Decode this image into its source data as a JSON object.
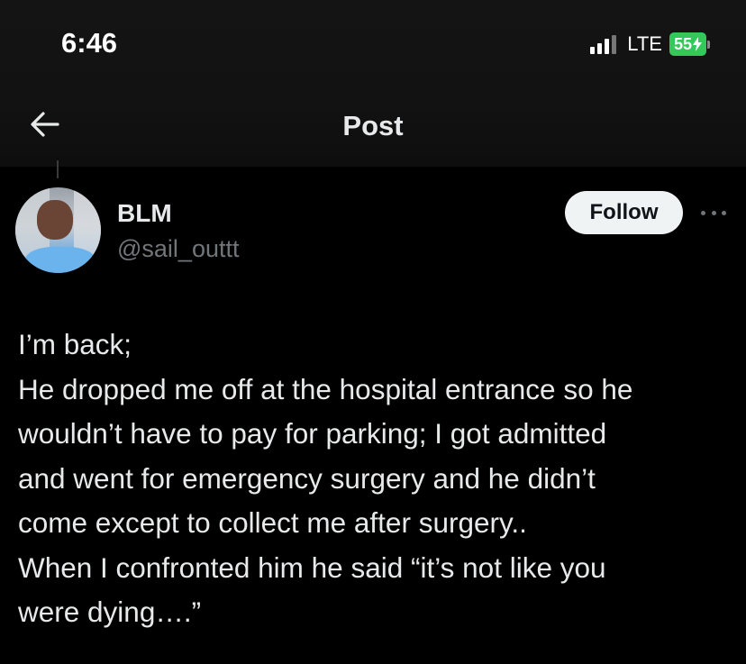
{
  "status_bar": {
    "time": "6:46",
    "network": "LTE",
    "battery": "55"
  },
  "nav": {
    "title": "Post"
  },
  "author": {
    "name": "BLM",
    "handle": "@sail_outtt"
  },
  "actions": {
    "follow_label": "Follow"
  },
  "post": {
    "lines": [
      "I’m back;",
      "He dropped me off at the hospital entrance so he",
      "wouldn’t have to pay for parking; I got admitted",
      "and went for emergency surgery and he didn’t",
      "come except to collect me after surgery..",
      "When I confronted him he said “it’s not like you",
      "were dying….”"
    ]
  },
  "colors": {
    "background": "#000000",
    "text_primary": "#e7e9ea",
    "text_secondary": "#71767b",
    "battery_green": "#34c759",
    "follow_bg": "#eff3f4"
  },
  "icons": [
    "back-arrow-icon",
    "more-icon",
    "signal-icon",
    "battery-icon"
  ]
}
